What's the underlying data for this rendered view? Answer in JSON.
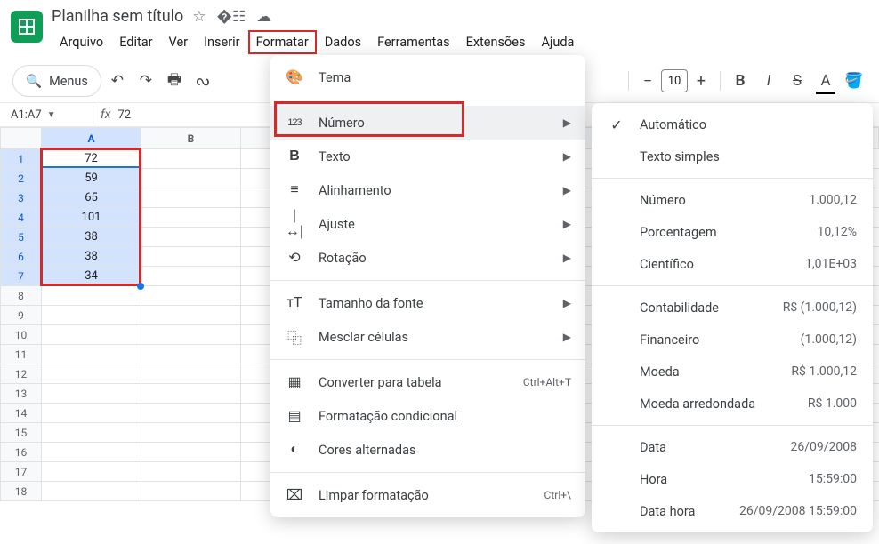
{
  "header": {
    "title": "Planilha sem título",
    "menubar": [
      "Arquivo",
      "Editar",
      "Ver",
      "Inserir",
      "Formatar",
      "Dados",
      "Ferramentas",
      "Extensões",
      "Ajuda"
    ],
    "highlighted_index": 4
  },
  "toolbar": {
    "menus_label": "Menus",
    "fontsize": "10"
  },
  "namebox": {
    "ref": "A1:A7",
    "formula": "72"
  },
  "grid": {
    "columns": [
      "A",
      "B"
    ],
    "rows": [
      1,
      2,
      3,
      4,
      5,
      6,
      7,
      8,
      9,
      10,
      11,
      12,
      13,
      14,
      15,
      16,
      17,
      18
    ],
    "colA": [
      "72",
      "59",
      "65",
      "101",
      "38",
      "38",
      "34"
    ]
  },
  "menu1": {
    "items": [
      {
        "icon": "🎨",
        "label": "Tema",
        "arrow": false
      },
      {
        "sep": true
      },
      {
        "icon": "123",
        "label": "Número",
        "arrow": true,
        "hov": true,
        "small": true
      },
      {
        "icon": "B",
        "label": "Texto",
        "arrow": true,
        "bold": true
      },
      {
        "icon": "≡",
        "label": "Alinhamento",
        "arrow": true
      },
      {
        "icon": "|↔|",
        "label": "Ajuste",
        "arrow": true
      },
      {
        "icon": "⟲",
        "label": "Rotação",
        "arrow": true
      },
      {
        "sep": true
      },
      {
        "icon": "тT",
        "label": "Tamanho da fonte",
        "arrow": true
      },
      {
        "icon": "⿻",
        "label": "Mesclar células",
        "arrow": true
      },
      {
        "sep": true
      },
      {
        "icon": "▦",
        "label": "Converter para tabela",
        "shortcut": "Ctrl+Alt+T"
      },
      {
        "icon": "▤",
        "label": "Formatação condicional"
      },
      {
        "icon": "◐",
        "label": "Cores alternadas"
      },
      {
        "sep": true
      },
      {
        "icon": "⌧",
        "label": "Limpar formatação",
        "shortcut": "Ctrl+\\"
      }
    ]
  },
  "menu2": {
    "items": [
      {
        "check": true,
        "label": "Automático"
      },
      {
        "label": "Texto simples"
      },
      {
        "sep": true
      },
      {
        "label": "Número",
        "right": "1.000,12"
      },
      {
        "label": "Porcentagem",
        "right": "10,12%"
      },
      {
        "label": "Científico",
        "right": "1,01E+03"
      },
      {
        "sep": true
      },
      {
        "label": "Contabilidade",
        "right": "R$ (1.000,12)"
      },
      {
        "label": "Financeiro",
        "right": "(1.000,12)"
      },
      {
        "label": "Moeda",
        "right": "R$ 1.000,12"
      },
      {
        "label": "Moeda arredondada",
        "right": "R$ 1.000"
      },
      {
        "sep": true
      },
      {
        "label": "Data",
        "right": "26/09/2008"
      },
      {
        "label": "Hora",
        "right": "15:59:00"
      },
      {
        "label": "Data hora",
        "right": "26/09/2008 15:59:00"
      }
    ]
  }
}
